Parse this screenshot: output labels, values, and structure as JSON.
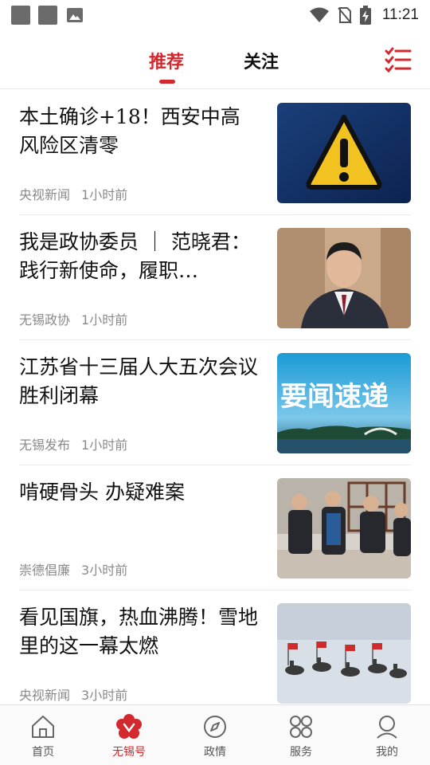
{
  "status_bar": {
    "time": "11:21"
  },
  "top_tabs": [
    {
      "label": "推荐",
      "active": true
    },
    {
      "label": "关注",
      "active": false
    }
  ],
  "accent_color": "#d2282e",
  "feed": [
    {
      "title": "本土确诊+18！西安中高风险区清零",
      "source": "央视新闻",
      "time": "1小时前",
      "thumb": "warning-sign-image"
    },
    {
      "title": "我是政协委员 ｜ 范晓君：践行新使命，履职…",
      "source": "无锡政协",
      "time": "1小时前",
      "thumb": "man-speaking-image"
    },
    {
      "title": "江苏省十三届人大五次会议胜利闭幕",
      "source": "无锡发布",
      "time": "1小时前",
      "thumb": "news-banner-image",
      "thumb_text": "要闻速递"
    },
    {
      "title": "啃硬骨头  办疑难案",
      "source": "崇德倡廉",
      "time": "3小时前",
      "thumb": "meeting-photo-image"
    },
    {
      "title": "看见国旗，热血沸腾！雪地里的这一幕太燃",
      "source": "央视新闻",
      "time": "3小时前",
      "thumb": "snow-riders-image"
    }
  ],
  "bottom_nav": [
    {
      "label": "首页",
      "icon": "home-icon",
      "active": false
    },
    {
      "label": "无锡号",
      "icon": "wuxi-flower-icon",
      "active": true
    },
    {
      "label": "政情",
      "icon": "compass-icon",
      "active": false
    },
    {
      "label": "服务",
      "icon": "services-grid-icon",
      "active": false
    },
    {
      "label": "我的",
      "icon": "profile-icon",
      "active": false
    }
  ]
}
